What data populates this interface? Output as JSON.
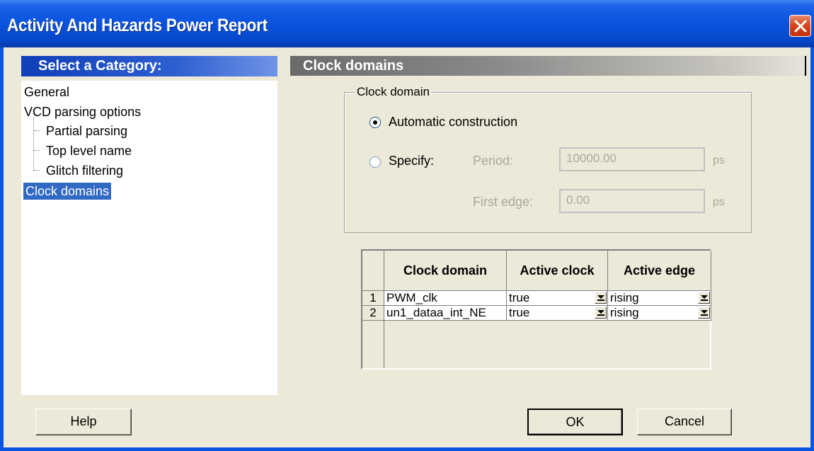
{
  "window": {
    "title": "Activity And Hazards Power Report"
  },
  "left_panel": {
    "header": "Select a Category:",
    "items": [
      {
        "label": "General"
      },
      {
        "label": "VCD parsing options"
      },
      {
        "label": "Partial parsing"
      },
      {
        "label": "Top level name"
      },
      {
        "label": "Glitch filtering"
      },
      {
        "label": "Clock domains"
      }
    ]
  },
  "right_panel": {
    "header": "Clock domains",
    "group_label": "Clock domain",
    "automatic_label": "Automatic construction",
    "specify_label": "Specify:",
    "period_label": "Period:",
    "period_value": "10000.00",
    "period_unit": "ps",
    "first_edge_label": "First edge:",
    "first_edge_value": "0.00",
    "first_edge_unit": "ps",
    "selected_option": "Automatic construction"
  },
  "table": {
    "headers": [
      "Clock domain",
      "Active clock",
      "Active edge"
    ],
    "rows": [
      {
        "num": "1",
        "domain": "PWM_clk",
        "active_clock": "true",
        "active_edge": "rising"
      },
      {
        "num": "2",
        "domain": "un1_dataa_int_NE",
        "active_clock": "true",
        "active_edge": "rising"
      }
    ]
  },
  "buttons": {
    "help": "Help",
    "ok": "OK",
    "cancel": "Cancel"
  }
}
